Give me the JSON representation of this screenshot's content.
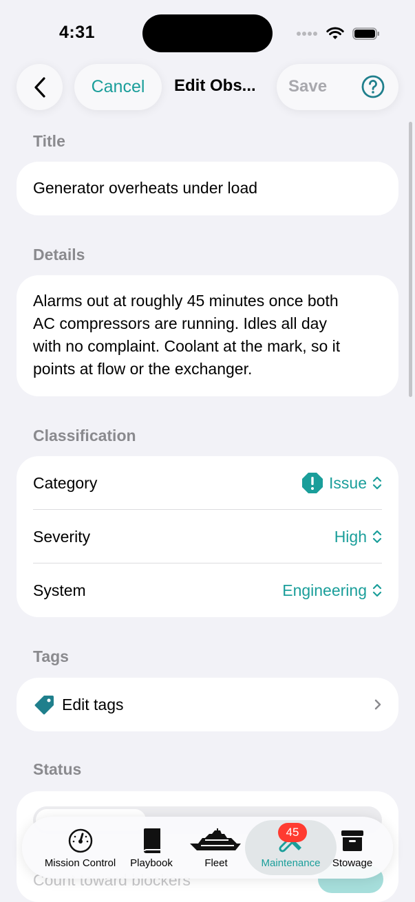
{
  "status_bar": {
    "time": "4:31"
  },
  "nav": {
    "cancel_label": "Cancel",
    "title": "Edit Obs...",
    "save_label": "Save"
  },
  "form": {
    "title_label": "Title",
    "title_value": "Generator overheats under load",
    "details_label": "Details",
    "details_lines": [
      "Alarms out at roughly 45 minutes once both",
      "AC compressors are running. Idles all day",
      "with no complaint. Coolant at the mark, so it",
      "points at flow or the exchanger."
    ],
    "classification_label": "Classification",
    "classification_rows": [
      {
        "label": "Category",
        "value": "Issue",
        "icon": "exclamation-octagon-icon"
      },
      {
        "label": "Severity",
        "value": "High"
      },
      {
        "label": "System",
        "value": "Engineering"
      }
    ],
    "tags_label": "Tags",
    "edit_tags_label": "Edit tags",
    "status_label": "Status",
    "blockers_label": "Count toward blockers"
  },
  "tab_bar": {
    "tabs": [
      {
        "label": "Mission Control",
        "icon": "gauge-icon"
      },
      {
        "label": "Playbook",
        "icon": "book-icon"
      },
      {
        "label": "Fleet",
        "icon": "yacht-icon"
      },
      {
        "label": "Maintenance",
        "icon": "wrench-screwdriver-icon",
        "active": true,
        "badge": "45"
      },
      {
        "label": "Stowage",
        "icon": "archive-box-icon"
      }
    ]
  },
  "colors": {
    "accent": "#1a9e9a",
    "badge": "#ff3b30",
    "background": "#f2f2f7"
  }
}
